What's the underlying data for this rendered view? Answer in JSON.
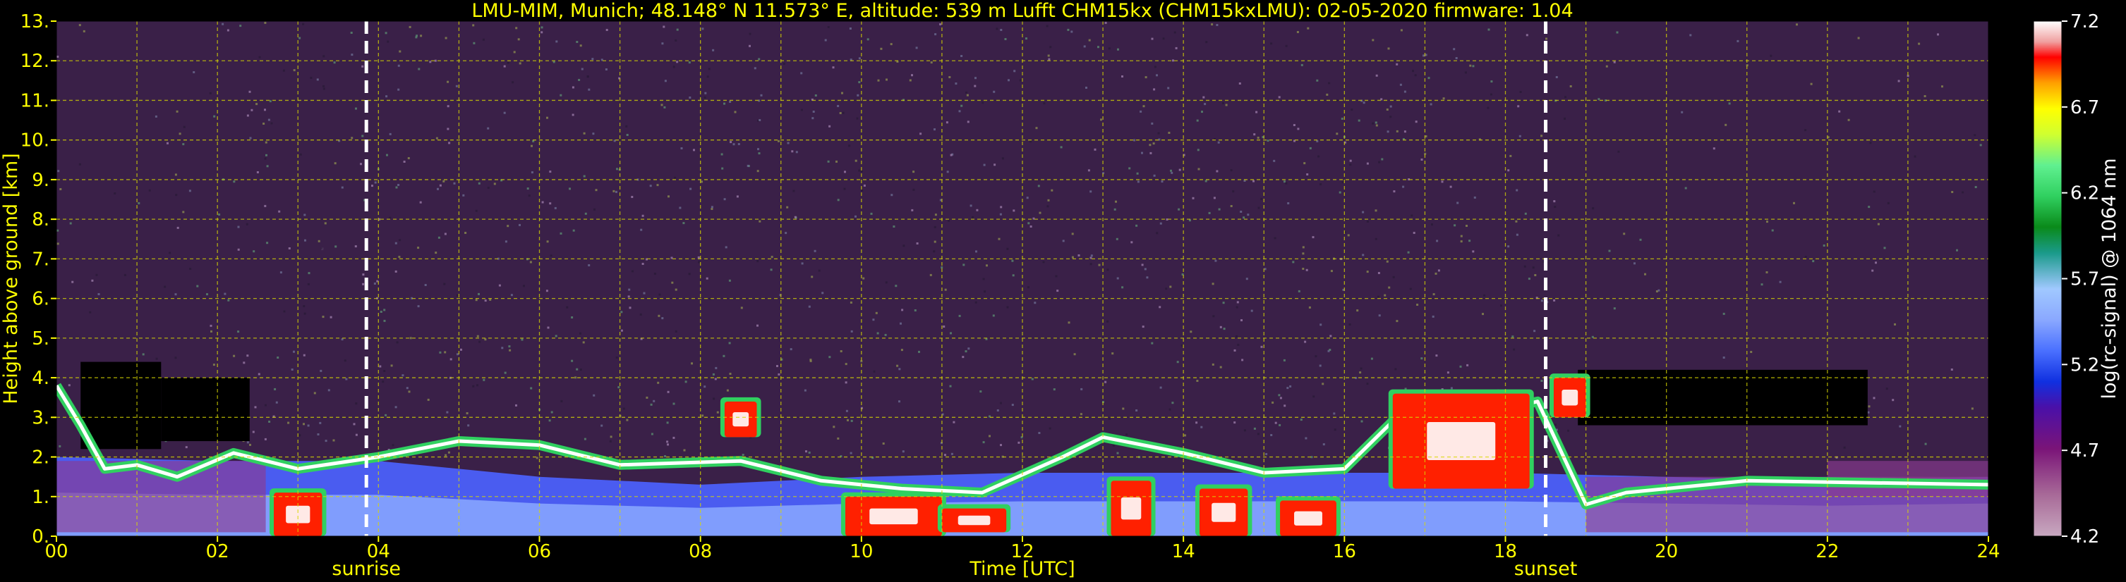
{
  "chart_data": {
    "type": "heatmap",
    "title": "LMU-MIM, Munich; 48.148° N 11.573° E, altitude: 539 m    Lufft CHM15kx (CHM15kxLMU): 02-05-2020    firmware: 1.04",
    "xlabel": "Time [UTC]",
    "ylabel": "Height above ground [km]",
    "xlim": [
      0,
      24
    ],
    "ylim": [
      0,
      13
    ],
    "x_ticks": [
      "00",
      "02",
      "04",
      "06",
      "08",
      "10",
      "12",
      "14",
      "16",
      "18",
      "20",
      "22",
      "24"
    ],
    "y_ticks": [
      "0.",
      "1.",
      "2.",
      "3.",
      "4.",
      "5.",
      "6.",
      "7.",
      "8.",
      "9.",
      "10.",
      "11.",
      "12.",
      "13."
    ],
    "grid": true,
    "colorbar": {
      "label": "log(rc-signal) @ 1064 nm",
      "range": [
        4.2,
        7.2
      ],
      "ticks": [
        "4.2",
        "4.7",
        "5.2",
        "5.7",
        "6.2",
        "6.7",
        "7.2"
      ]
    },
    "events": [
      {
        "label": "sunrise",
        "time": 3.85
      },
      {
        "label": "sunset",
        "time": 18.5
      }
    ],
    "boundary_layer": [
      {
        "t": 0.0,
        "h": 2.0
      },
      {
        "t": 2.0,
        "h": 1.9
      },
      {
        "t": 4.0,
        "h": 1.9
      },
      {
        "t": 6.0,
        "h": 1.5
      },
      {
        "t": 8.0,
        "h": 1.3
      },
      {
        "t": 10.0,
        "h": 1.5
      },
      {
        "t": 12.0,
        "h": 1.6
      },
      {
        "t": 14.0,
        "h": 1.6
      },
      {
        "t": 16.0,
        "h": 1.6
      },
      {
        "t": 18.0,
        "h": 1.6
      },
      {
        "t": 20.0,
        "h": 1.5
      },
      {
        "t": 22.0,
        "h": 1.4
      },
      {
        "t": 24.0,
        "h": 1.5
      }
    ],
    "cloud_layer": [
      {
        "t": 0.0,
        "h": 3.8
      },
      {
        "t": 0.3,
        "h": 2.8
      },
      {
        "t": 0.6,
        "h": 1.7
      },
      {
        "t": 1.0,
        "h": 1.8
      },
      {
        "t": 1.5,
        "h": 1.5
      },
      {
        "t": 2.2,
        "h": 2.1
      },
      {
        "t": 3.0,
        "h": 1.7
      },
      {
        "t": 4.0,
        "h": 2.0
      },
      {
        "t": 5.0,
        "h": 2.4
      },
      {
        "t": 6.0,
        "h": 2.3
      },
      {
        "t": 7.0,
        "h": 1.8
      },
      {
        "t": 8.5,
        "h": 1.9
      },
      {
        "t": 9.5,
        "h": 1.4
      },
      {
        "t": 10.5,
        "h": 1.2
      },
      {
        "t": 11.5,
        "h": 1.1
      },
      {
        "t": 12.5,
        "h": 2.0
      },
      {
        "t": 13.0,
        "h": 2.5
      },
      {
        "t": 14.0,
        "h": 2.1
      },
      {
        "t": 15.0,
        "h": 1.6
      },
      {
        "t": 16.0,
        "h": 1.7
      },
      {
        "t": 16.6,
        "h": 2.9
      },
      {
        "t": 17.5,
        "h": 3.0
      },
      {
        "t": 18.4,
        "h": 3.4
      },
      {
        "t": 19.0,
        "h": 0.8
      },
      {
        "t": 19.5,
        "h": 1.1
      },
      {
        "t": 21.0,
        "h": 1.4
      },
      {
        "t": 24.0,
        "h": 1.3
      }
    ],
    "intense_regions": [
      {
        "t0": 2.7,
        "t1": 3.3,
        "h0": 0.0,
        "h1": 1.1
      },
      {
        "t0": 9.8,
        "t1": 11.0,
        "h0": 0.0,
        "h1": 1.0
      },
      {
        "t0": 11.0,
        "t1": 11.8,
        "h0": 0.1,
        "h1": 0.7
      },
      {
        "t0": 13.1,
        "t1": 13.6,
        "h0": 0.0,
        "h1": 1.4
      },
      {
        "t0": 14.2,
        "t1": 14.8,
        "h0": 0.0,
        "h1": 1.2
      },
      {
        "t0": 15.2,
        "t1": 15.9,
        "h0": 0.0,
        "h1": 0.9
      },
      {
        "t0": 16.6,
        "t1": 18.3,
        "h0": 1.2,
        "h1": 3.6
      },
      {
        "t0": 8.3,
        "t1": 8.7,
        "h0": 2.5,
        "h1": 3.4
      },
      {
        "t0": 18.6,
        "t1": 19.0,
        "h0": 3.0,
        "h1": 4.0
      }
    ]
  }
}
